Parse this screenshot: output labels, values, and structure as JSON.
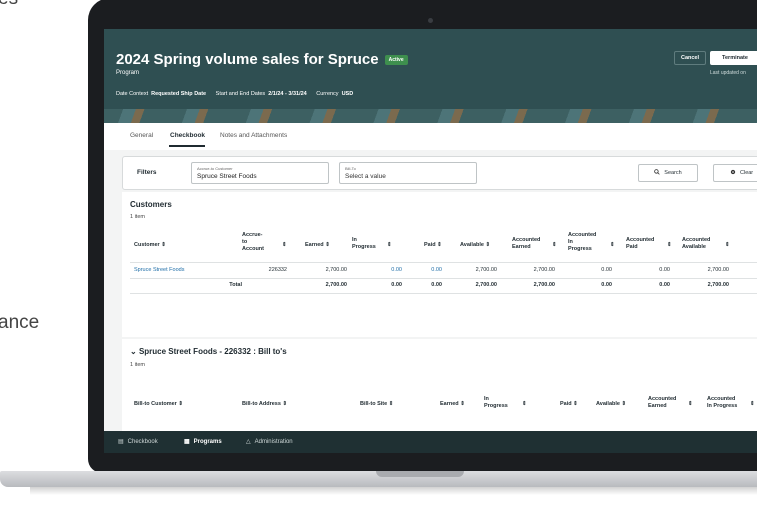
{
  "side": {
    "text_top": "es",
    "text_mid": "ance"
  },
  "header": {
    "title": "2024 Spring volume sales for Spruce",
    "badge": "Active",
    "subtitle": "Program",
    "date_context_label": "Date Context",
    "date_context_value": "Requested Ship Date",
    "dates_label": "Start and End Dates",
    "dates_value": "2/1/24 - 3/31/24",
    "currency_label": "Currency",
    "currency_value": "USD",
    "cancel_label": "Cancel",
    "terminate_label": "Terminate",
    "updated_text": "Last updated on"
  },
  "tabs": [
    "General",
    "Checkbook",
    "Notes and Attachments"
  ],
  "filters": {
    "label": "Filters",
    "accrue_small": "Accrue-to Customer",
    "accrue_value": "Spruce Street Foods",
    "billto_small": "Bill-To",
    "billto_placeholder": "Select a value",
    "search_label": "Search",
    "clear_label": "Clear"
  },
  "customers": {
    "title": "Customers",
    "count": "1 item",
    "headers": {
      "customer": "Customer",
      "accrue": "Accrue-\nto\nAccount",
      "earned": "Earned",
      "in_progress": "In\nProgress",
      "paid": "Paid",
      "available": "Available",
      "acc_earned": "Accounted\nEarned",
      "acc_in_progress": "Accounted\nIn\nProgress",
      "acc_paid": "Accounted\nPaid",
      "acc_available": "Accounted\nAvailable"
    },
    "row": {
      "customer": "Spruce Street Foods",
      "account": "226332",
      "earned": "2,700.00",
      "in_progress": "0.00",
      "paid": "0.00",
      "available": "2,700.00",
      "acc_earned": "2,700.00",
      "acc_in_progress": "0.00",
      "acc_paid": "0.00",
      "acc_available": "2,700.00"
    },
    "total": {
      "label": "Total",
      "earned": "2,700.00",
      "in_progress": "0.00",
      "paid": "0.00",
      "available": "2,700.00",
      "acc_earned": "2,700.00",
      "acc_in_progress": "0.00",
      "acc_paid": "0.00",
      "acc_available": "2,700.00"
    }
  },
  "billto": {
    "title": "Spruce Street Foods - 226332 : Bill to's",
    "count": "1 item",
    "headers": {
      "customer": "Bill-to Customer",
      "address": "Bill-to Address",
      "site": "Bill-to Site",
      "earned": "Earned",
      "in_progress": "In\nProgress",
      "paid": "Paid",
      "available": "Available",
      "acc_earned": "Accounted\nEarned",
      "acc_in_progress": "Accounted\nIn Progress"
    }
  },
  "bottomnav": [
    "Checkbook",
    "Programs",
    "Administration"
  ],
  "sort_glyph": "⇕"
}
